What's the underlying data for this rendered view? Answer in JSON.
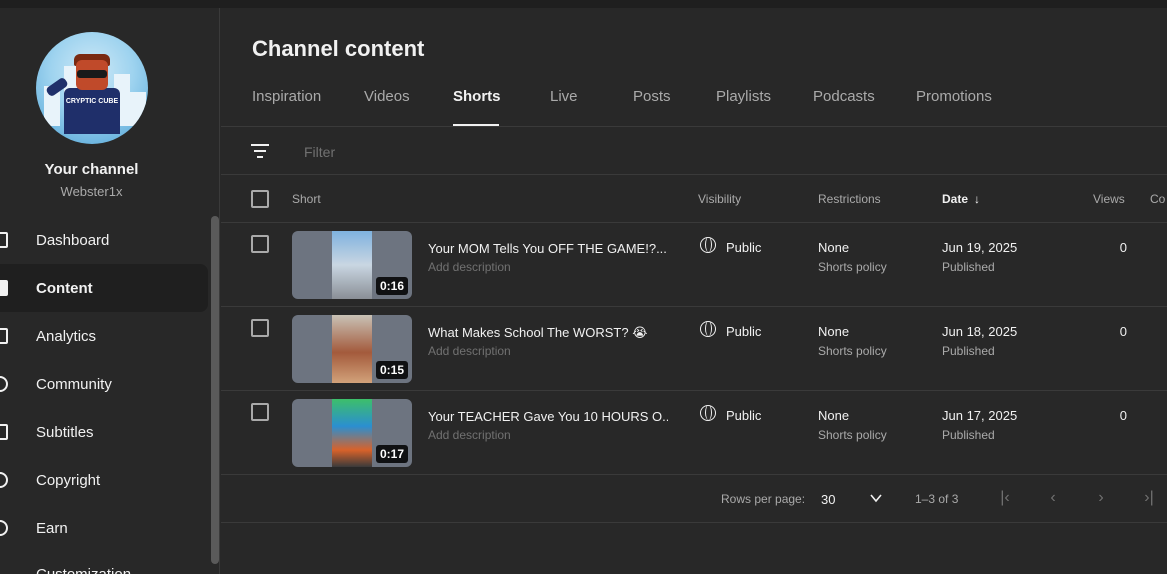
{
  "sidebar": {
    "avatar_text": "CRYPTIC CUBE",
    "channel_name": "Your channel",
    "handle": "Webster1x",
    "items": [
      {
        "label": "Dashboard"
      },
      {
        "label": "Content"
      },
      {
        "label": "Analytics"
      },
      {
        "label": "Community"
      },
      {
        "label": "Subtitles"
      },
      {
        "label": "Copyright"
      },
      {
        "label": "Earn"
      },
      {
        "label": "Customization"
      }
    ]
  },
  "main": {
    "title": "Channel content",
    "tabs": [
      {
        "label": "Inspiration"
      },
      {
        "label": "Videos"
      },
      {
        "label": "Shorts"
      },
      {
        "label": "Live"
      },
      {
        "label": "Posts"
      },
      {
        "label": "Playlists"
      },
      {
        "label": "Podcasts"
      },
      {
        "label": "Promotions"
      }
    ],
    "active_tab": "Shorts",
    "filter_placeholder": "Filter",
    "columns": {
      "short": "Short",
      "visibility": "Visibility",
      "restrictions": "Restrictions",
      "date": "Date",
      "date_sort": "↓",
      "views": "Views",
      "comments": "Co"
    },
    "rows": [
      {
        "title": "Your MOM Tells You OFF THE GAME!?...",
        "description": "Add description",
        "duration": "0:16",
        "visibility": "Public",
        "restriction": "None",
        "restriction_sub": "Shorts policy",
        "date": "Jun 19, 2025",
        "status": "Published",
        "views": "0"
      },
      {
        "title": "What Makes School The WORST? 😭",
        "description": "Add description",
        "duration": "0:15",
        "visibility": "Public",
        "restriction": "None",
        "restriction_sub": "Shorts policy",
        "date": "Jun 18, 2025",
        "status": "Published",
        "views": "0"
      },
      {
        "title": "Your TEACHER Gave You 10 HOURS O...",
        "description": "Add description",
        "duration": "0:17",
        "visibility": "Public",
        "restriction": "None",
        "restriction_sub": "Shorts policy",
        "date": "Jun 17, 2025",
        "status": "Published",
        "views": "0"
      }
    ],
    "pagination": {
      "rows_per_page_label": "Rows per page:",
      "rows_per_page_value": "30",
      "range": "1–3 of 3"
    }
  },
  "colors": {
    "background": "#282828",
    "sidebar_active": "#1f1f1f",
    "text_primary": "#f1f1f1",
    "text_secondary": "#aaaaaa",
    "divider": "#3a3a3a"
  }
}
